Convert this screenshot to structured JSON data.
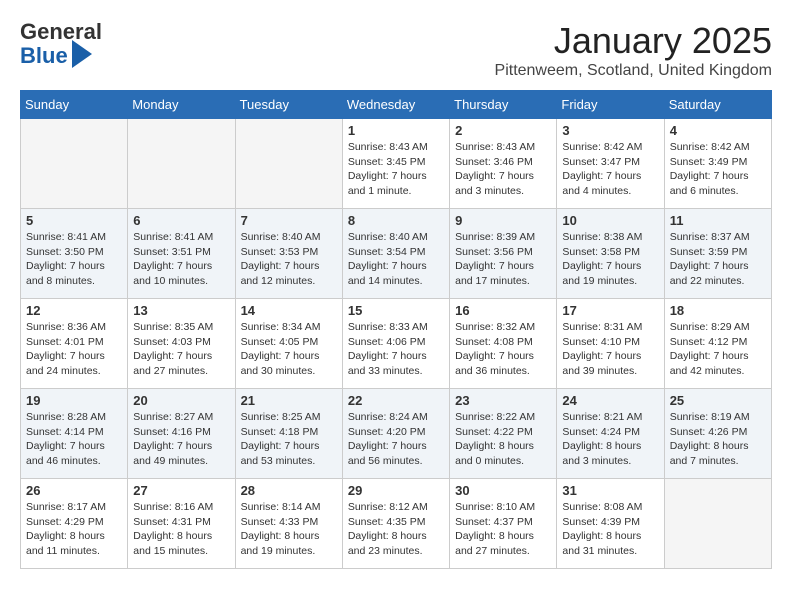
{
  "header": {
    "logo_line1": "General",
    "logo_line2": "Blue",
    "month_title": "January 2025",
    "location": "Pittenweem, Scotland, United Kingdom"
  },
  "weekdays": [
    "Sunday",
    "Monday",
    "Tuesday",
    "Wednesday",
    "Thursday",
    "Friday",
    "Saturday"
  ],
  "weeks": [
    [
      {
        "day": "",
        "info": ""
      },
      {
        "day": "",
        "info": ""
      },
      {
        "day": "",
        "info": ""
      },
      {
        "day": "1",
        "info": "Sunrise: 8:43 AM\nSunset: 3:45 PM\nDaylight: 7 hours\nand 1 minute."
      },
      {
        "day": "2",
        "info": "Sunrise: 8:43 AM\nSunset: 3:46 PM\nDaylight: 7 hours\nand 3 minutes."
      },
      {
        "day": "3",
        "info": "Sunrise: 8:42 AM\nSunset: 3:47 PM\nDaylight: 7 hours\nand 4 minutes."
      },
      {
        "day": "4",
        "info": "Sunrise: 8:42 AM\nSunset: 3:49 PM\nDaylight: 7 hours\nand 6 minutes."
      }
    ],
    [
      {
        "day": "5",
        "info": "Sunrise: 8:41 AM\nSunset: 3:50 PM\nDaylight: 7 hours\nand 8 minutes."
      },
      {
        "day": "6",
        "info": "Sunrise: 8:41 AM\nSunset: 3:51 PM\nDaylight: 7 hours\nand 10 minutes."
      },
      {
        "day": "7",
        "info": "Sunrise: 8:40 AM\nSunset: 3:53 PM\nDaylight: 7 hours\nand 12 minutes."
      },
      {
        "day": "8",
        "info": "Sunrise: 8:40 AM\nSunset: 3:54 PM\nDaylight: 7 hours\nand 14 minutes."
      },
      {
        "day": "9",
        "info": "Sunrise: 8:39 AM\nSunset: 3:56 PM\nDaylight: 7 hours\nand 17 minutes."
      },
      {
        "day": "10",
        "info": "Sunrise: 8:38 AM\nSunset: 3:58 PM\nDaylight: 7 hours\nand 19 minutes."
      },
      {
        "day": "11",
        "info": "Sunrise: 8:37 AM\nSunset: 3:59 PM\nDaylight: 7 hours\nand 22 minutes."
      }
    ],
    [
      {
        "day": "12",
        "info": "Sunrise: 8:36 AM\nSunset: 4:01 PM\nDaylight: 7 hours\nand 24 minutes."
      },
      {
        "day": "13",
        "info": "Sunrise: 8:35 AM\nSunset: 4:03 PM\nDaylight: 7 hours\nand 27 minutes."
      },
      {
        "day": "14",
        "info": "Sunrise: 8:34 AM\nSunset: 4:05 PM\nDaylight: 7 hours\nand 30 minutes."
      },
      {
        "day": "15",
        "info": "Sunrise: 8:33 AM\nSunset: 4:06 PM\nDaylight: 7 hours\nand 33 minutes."
      },
      {
        "day": "16",
        "info": "Sunrise: 8:32 AM\nSunset: 4:08 PM\nDaylight: 7 hours\nand 36 minutes."
      },
      {
        "day": "17",
        "info": "Sunrise: 8:31 AM\nSunset: 4:10 PM\nDaylight: 7 hours\nand 39 minutes."
      },
      {
        "day": "18",
        "info": "Sunrise: 8:29 AM\nSunset: 4:12 PM\nDaylight: 7 hours\nand 42 minutes."
      }
    ],
    [
      {
        "day": "19",
        "info": "Sunrise: 8:28 AM\nSunset: 4:14 PM\nDaylight: 7 hours\nand 46 minutes."
      },
      {
        "day": "20",
        "info": "Sunrise: 8:27 AM\nSunset: 4:16 PM\nDaylight: 7 hours\nand 49 minutes."
      },
      {
        "day": "21",
        "info": "Sunrise: 8:25 AM\nSunset: 4:18 PM\nDaylight: 7 hours\nand 53 minutes."
      },
      {
        "day": "22",
        "info": "Sunrise: 8:24 AM\nSunset: 4:20 PM\nDaylight: 7 hours\nand 56 minutes."
      },
      {
        "day": "23",
        "info": "Sunrise: 8:22 AM\nSunset: 4:22 PM\nDaylight: 8 hours\nand 0 minutes."
      },
      {
        "day": "24",
        "info": "Sunrise: 8:21 AM\nSunset: 4:24 PM\nDaylight: 8 hours\nand 3 minutes."
      },
      {
        "day": "25",
        "info": "Sunrise: 8:19 AM\nSunset: 4:26 PM\nDaylight: 8 hours\nand 7 minutes."
      }
    ],
    [
      {
        "day": "26",
        "info": "Sunrise: 8:17 AM\nSunset: 4:29 PM\nDaylight: 8 hours\nand 11 minutes."
      },
      {
        "day": "27",
        "info": "Sunrise: 8:16 AM\nSunset: 4:31 PM\nDaylight: 8 hours\nand 15 minutes."
      },
      {
        "day": "28",
        "info": "Sunrise: 8:14 AM\nSunset: 4:33 PM\nDaylight: 8 hours\nand 19 minutes."
      },
      {
        "day": "29",
        "info": "Sunrise: 8:12 AM\nSunset: 4:35 PM\nDaylight: 8 hours\nand 23 minutes."
      },
      {
        "day": "30",
        "info": "Sunrise: 8:10 AM\nSunset: 4:37 PM\nDaylight: 8 hours\nand 27 minutes."
      },
      {
        "day": "31",
        "info": "Sunrise: 8:08 AM\nSunset: 4:39 PM\nDaylight: 8 hours\nand 31 minutes."
      },
      {
        "day": "",
        "info": ""
      }
    ]
  ]
}
